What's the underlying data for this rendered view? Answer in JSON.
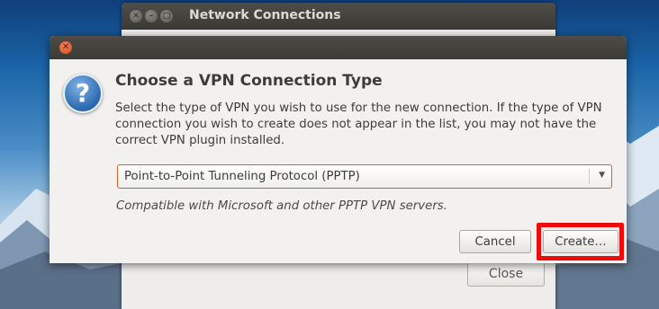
{
  "background_window": {
    "title": "Network Connections",
    "close_label": "Close"
  },
  "dialog": {
    "heading": "Choose a VPN Connection Type",
    "description": "Select the type of VPN you wish to use for the new connection.  If the type of VPN connection you wish to create does not appear in the list, you may not have the correct VPN plugin installed.",
    "vpn_type_selected": "Point-to-Point Tunneling Protocol (PPTP)",
    "compatibility_note": "Compatible with Microsoft and other PPTP VPN servers.",
    "cancel_label": "Cancel",
    "create_label": "Create…"
  },
  "icons": {
    "question": "?",
    "close": "✕",
    "dropdown": "▼"
  },
  "colors": {
    "highlight": "#ee0b0b",
    "combo_border": "#e05a2a"
  }
}
